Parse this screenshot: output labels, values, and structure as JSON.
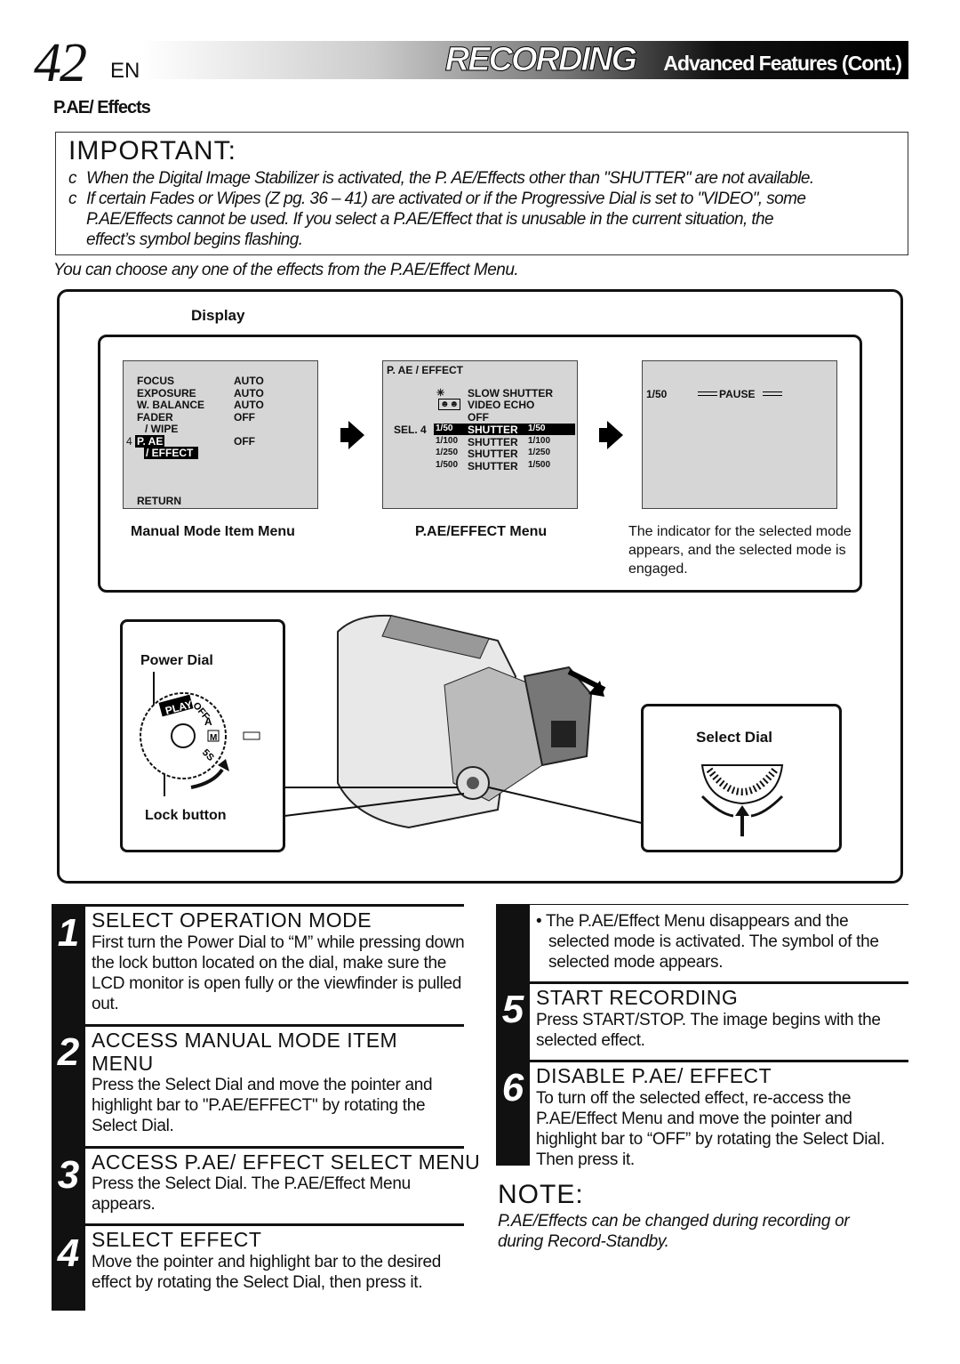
{
  "header": {
    "page_number": "42",
    "lang": "EN",
    "title": "RECORDING",
    "subtitle": "Advanced Features (Cont.)"
  },
  "section_title": "P.AE/ Effects",
  "important": {
    "heading": "IMPORTANT:",
    "bullet": "c",
    "lines": [
      "When the Digital Image Stabilizer is activated, the P. AE/Effects other than \"SHUTTER\" are not available.",
      "If certain Fades or Wipes (Z  pg. 36 – 41) are activated or if the Progressive Dial is set to \"VIDEO\", some",
      "P.AE/Effects cannot be used. If you select a P.AE/Effect that is unusable in the current situation, the",
      "effect’s symbol begins flashing."
    ]
  },
  "intro": "You can choose any one of the effects from the P.AE/Effect Menu.",
  "display": {
    "label": "Display",
    "manual_menu": {
      "items": [
        [
          "FOCUS",
          "AUTO"
        ],
        [
          "EXPOSURE",
          "AUTO"
        ],
        [
          "W. BALANCE",
          "AUTO"
        ],
        [
          "FADER",
          "OFF"
        ],
        [
          "/ WIPE",
          ""
        ]
      ],
      "pointer": "4",
      "selected_1": "P. AE",
      "selected_2": "/ EFFECT",
      "selected_value": "OFF",
      "return": "RETURN",
      "caption": "Manual Mode Item Menu"
    },
    "effect_menu": {
      "title": "P. AE / EFFECT",
      "items": [
        "SLOW SHUTTER",
        "VIDEO ECHO",
        "OFF"
      ],
      "sel": "SEL. 4",
      "shutters": [
        [
          "1/50",
          "SHUTTER",
          "1/50"
        ],
        [
          "1/100",
          "SHUTTER",
          "1/100"
        ],
        [
          "1/250",
          "SHUTTER",
          "1/250"
        ],
        [
          "1/500",
          "SHUTTER",
          "1/500"
        ]
      ],
      "caption": "P.AE/EFFECT Menu"
    },
    "result": {
      "indicator": "1/50",
      "status": "PAUSE",
      "caption": "The indicator for the selected mode appears, and the selected mode is engaged."
    }
  },
  "dial": {
    "power_dial": "Power Dial",
    "lock_button": "Lock button",
    "select_dial": "Select Dial",
    "play": "PLAY",
    "off": "OFF",
    "a": "A",
    "m": "M",
    "ss": "5S"
  },
  "steps": [
    {
      "n": "1",
      "title": "SELECT OPERATION MODE",
      "body": "First turn the Power Dial to “M” while pressing down the lock button located on the dial, make sure the LCD monitor is open fully or the viewfinder is pulled out."
    },
    {
      "n": "2",
      "title": "ACCESS MANUAL MODE ITEM MENU",
      "body": "Press the Select Dial and move the pointer and highlight bar to \"P.AE/EFFECT\" by rotating the Select Dial."
    },
    {
      "n": "3",
      "title": "ACCESS P.AE/ EFFECT SELECT MENU",
      "body": "Press the Select Dial. The P.AE/Effect Menu appears."
    },
    {
      "n": "4",
      "title": "SELECT EFFECT",
      "body": "Move the pointer and highlight bar to the desired effect by rotating the Select Dial, then press it."
    },
    {
      "n": "",
      "title": "",
      "body": "• The P.AE/Effect Menu disappears and the selected mode is activated. The symbol of the selected mode appears."
    },
    {
      "n": "5",
      "title": "START RECORDING",
      "body": "Press START/STOP. The image begins with the selected effect."
    },
    {
      "n": "6",
      "title": "DISABLE P.AE/ EFFECT",
      "body": "To turn off the selected effect, re-access the P.AE/Effect Menu and move the pointer and highlight bar to “OFF” by rotating the Select Dial. Then press it."
    }
  ],
  "note": {
    "heading": "NOTE:",
    "text": "P.AE/Effects can be changed during recording or during Record-Standby."
  }
}
